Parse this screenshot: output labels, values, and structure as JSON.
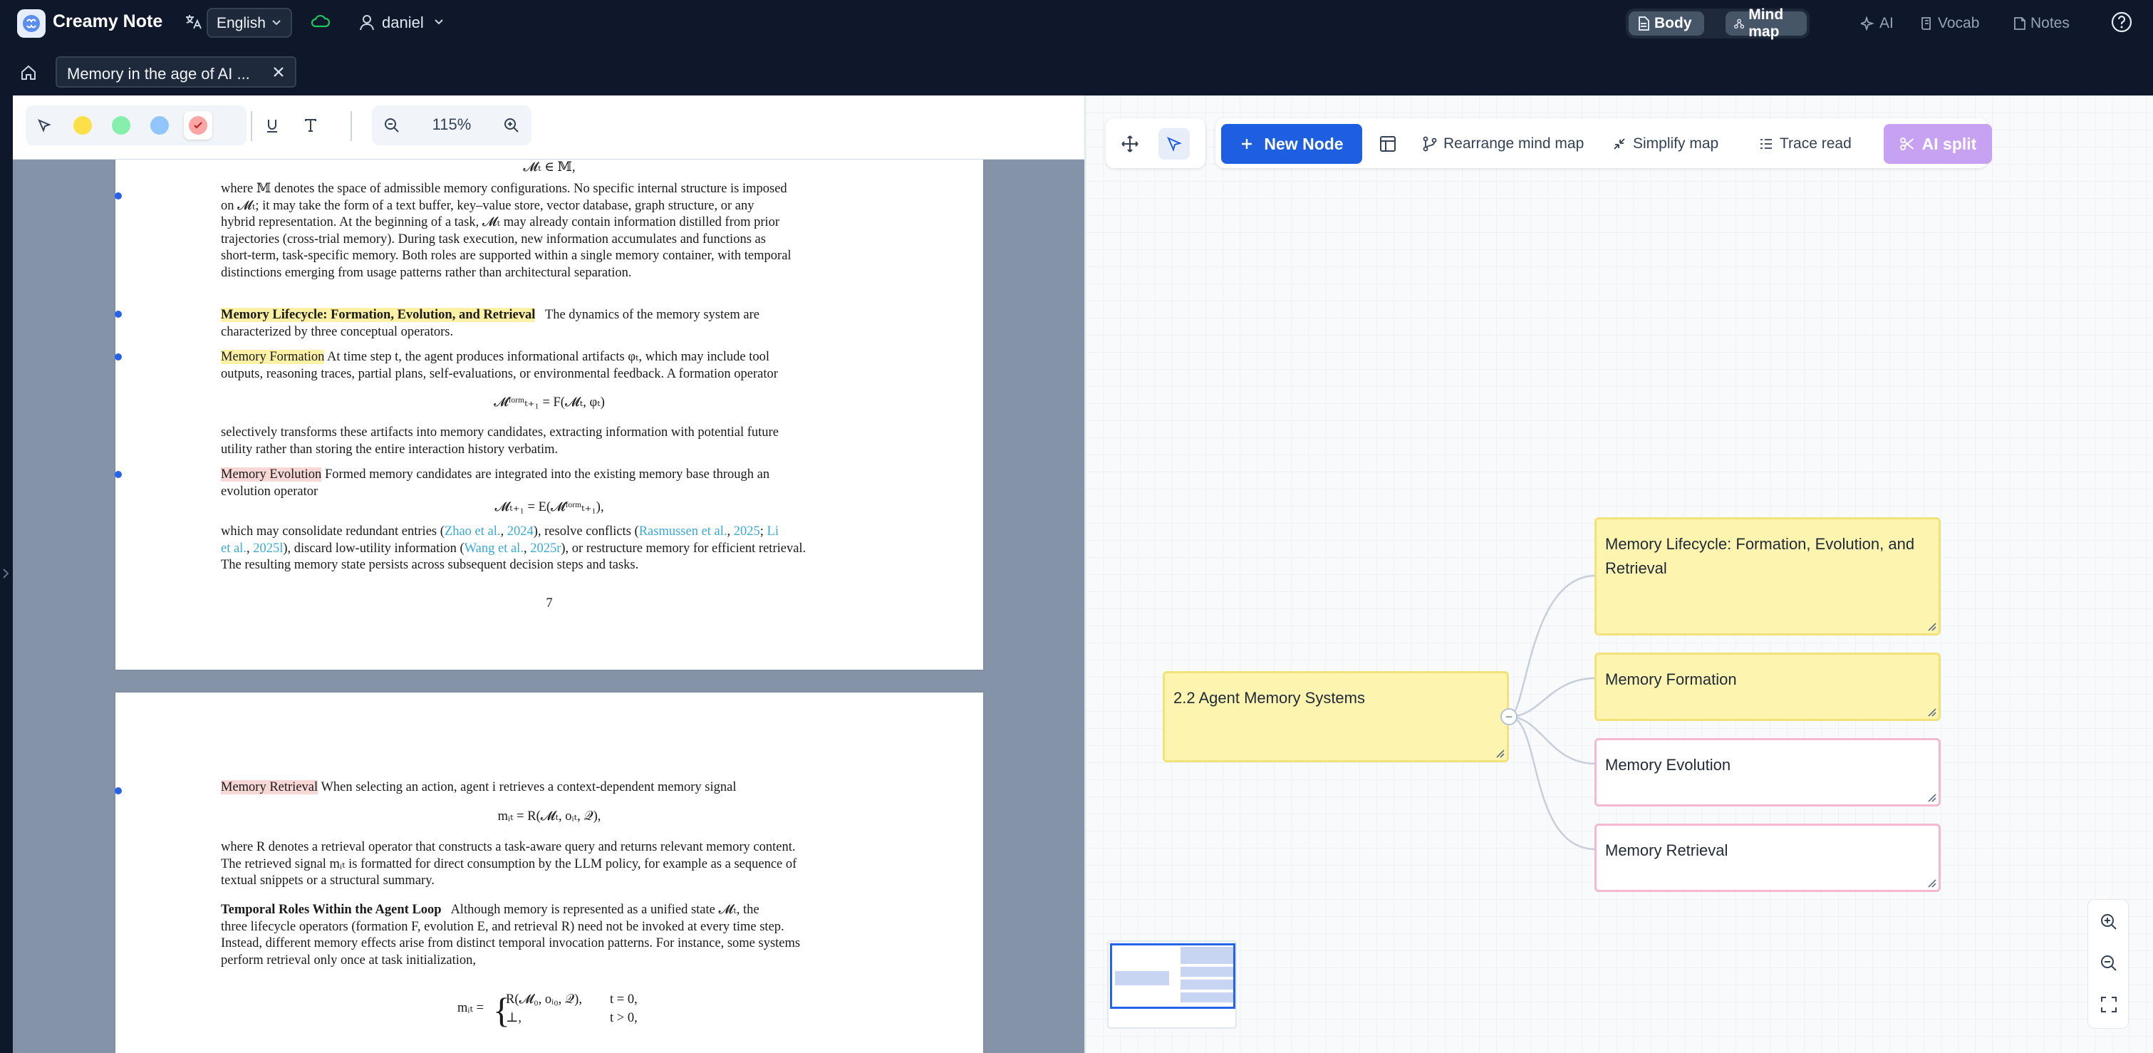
{
  "app": {
    "name": "Creamy Note",
    "language": "English",
    "user": "daniel"
  },
  "top_nav": {
    "body": "Body",
    "mind_map": "Mind map",
    "ai": "AI",
    "vocab": "Vocab",
    "notes": "Notes"
  },
  "doc_tab": {
    "title": "Memory in the age of AI ..."
  },
  "reader_toolbar": {
    "zoom": "115%",
    "highlight_colors": [
      "#fde047",
      "#86efac",
      "#93c5fd",
      "#fca5a5"
    ]
  },
  "page1": {
    "eq_top": "𝓜ₜ ∈ 𝕄,",
    "p1": [
      "where 𝕄 denotes the space of admissible memory configurations. No specific internal structure is imposed",
      "on 𝓜ₜ; it may take the form of a text buffer, key–value store, vector database, graph structure, or any",
      "hybrid representation. At the beginning of a task, 𝓜ₜ may already contain information distilled from prior",
      "trajectories (cross-trial memory). During task execution, new information accumulates and functions as",
      "short-term, task-specific memory. Both roles are supported within a single memory container, with temporal",
      "distinctions emerging from usage patterns rather than architectural separation."
    ],
    "lifecycle_heading": "Memory Lifecycle: Formation, Evolution, and Retrieval",
    "lifecycle_rest": "The dynamics of the memory system are",
    "lifecycle_line2": "characterized by three conceptual operators.",
    "formation_heading": "Memory Formation",
    "formation_rest": "At time step t, the agent produces informational artifacts φₜ, which may include tool",
    "formation_line2": "outputs, reasoning traces, partial plans, self-evaluations, or environmental feedback. A formation operator",
    "eq_formation": "𝓜ᶠᵒʳᵐₜ₊₁ = F(𝓜ₜ, φₜ)",
    "p_selective": [
      "selectively transforms these artifacts into memory candidates, extracting information with potential future",
      "utility rather than storing the entire interaction history verbatim."
    ],
    "evolution_heading": "Memory Evolution",
    "evolution_rest": "Formed memory candidates are integrated into the existing memory base through an",
    "evolution_line2": "evolution operator",
    "eq_evolution": "𝓜ₜ₊₁ = E(𝓜ᶠᵒʳᵐₜ₊₁),",
    "consolidate": {
      "a": "which may consolidate redundant entries (",
      "l1": "Zhao et al.",
      "b": ", ",
      "l2": "2024",
      "c": "), resolve conflicts (",
      "l3": "Rasmussen et al.",
      "d": ", ",
      "l4": "2025",
      "e": "; ",
      "l5": "Li",
      "l6": "et al.",
      "f": ", ",
      "l7": "2025l",
      "g": "), discard low-utility information (",
      "l8": "Wang et al.",
      "h": ", ",
      "l9": "2025r",
      "i": "), or restructure memory for efficient retrieval.",
      "line3": "The resulting memory state persists across subsequent decision steps and tasks."
    },
    "page_number": "7"
  },
  "page2": {
    "retrieval_heading": "Memory Retrieval",
    "retrieval_rest": "When selecting an action, agent i retrieves a context-dependent memory signal",
    "eq_retrieval": "mᵢₜ = R(𝓜ₜ, oᵢₜ, 𝒬),",
    "p_where": [
      "where R denotes a retrieval operator that constructs a task-aware query and returns relevant memory content.",
      "The retrieved signal mᵢₜ is formatted for direct consumption by the LLM policy, for example as a sequence of",
      "textual snippets or a structural summary."
    ],
    "temporal_heading": "Temporal Roles Within the Agent Loop",
    "temporal_rest": "Although memory is represented as a unified state 𝓜ₜ, the",
    "p_temporal": [
      "three lifecycle operators (formation F, evolution E, and retrieval R) need not be invoked at every time step.",
      "Instead, different memory effects arise from distinct temporal invocation patterns. For instance, some systems",
      "perform retrieval only once at task initialization,"
    ],
    "eq_case_lhs": "mᵢₜ =",
    "eq_case1": "R(𝓜₀, oᵢ₀, 𝒬),",
    "eq_case1_cond": "t = 0,",
    "eq_case2": "⊥,",
    "eq_case2_cond": "t > 0,"
  },
  "mindmap_toolbar": {
    "new_node": "New Node",
    "rearrange": "Rearrange mind map",
    "simplify": "Simplify map",
    "trace_read": "Trace read",
    "ai_split": "AI split"
  },
  "mindmap": {
    "root": "2.2 Agent Memory Systems",
    "children": [
      {
        "label": "Memory Lifecycle: Formation, Evolution, and Retrieval",
        "color": "yellow"
      },
      {
        "label": "Memory Formation",
        "color": "yellow"
      },
      {
        "label": "Memory Evolution",
        "color": "pink"
      },
      {
        "label": "Memory Retrieval",
        "color": "pink"
      }
    ],
    "collapse_symbol": "−"
  },
  "colors": {
    "accent": "#1d5fe0",
    "ai_split": "#c8a2f2",
    "node_yellow": "#fdf4b0",
    "node_pink_border": "#f5b8d2"
  }
}
